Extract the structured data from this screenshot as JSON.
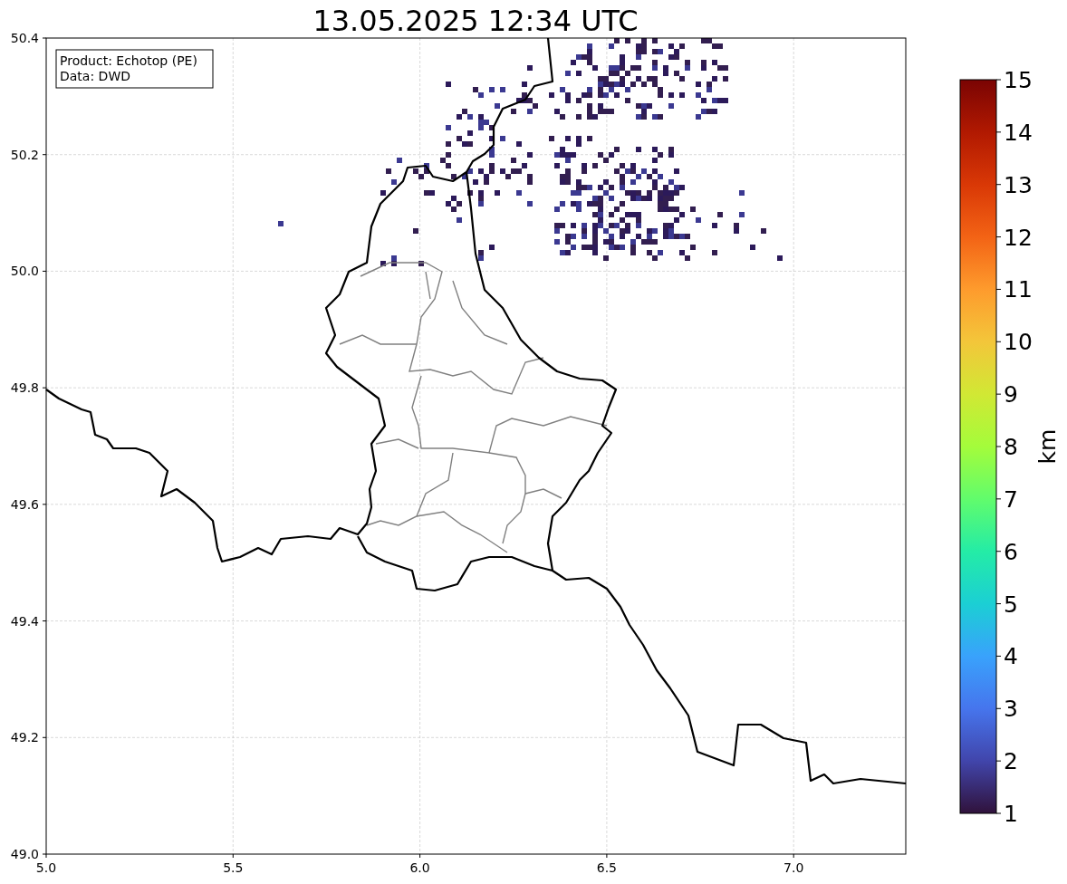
{
  "title": "13.05.2025 12:34 UTC",
  "info_box": {
    "lines": [
      "Product: Echotop (PE)",
      "Data: DWD"
    ]
  },
  "x_axis": {
    "ticks": [
      "5.0",
      "5.5",
      "6.0",
      "6.5",
      "7.0"
    ]
  },
  "y_axis": {
    "ticks": [
      "50.4",
      "50.2",
      "50.0",
      "49.8",
      "49.6",
      "49.4",
      "49.2",
      "49.0"
    ]
  },
  "colorbar": {
    "label": "km",
    "ticks": [
      "15",
      "14",
      "13",
      "12",
      "11",
      "10",
      "9",
      "8",
      "7",
      "6",
      "5",
      "4",
      "3",
      "2",
      "1"
    ]
  }
}
